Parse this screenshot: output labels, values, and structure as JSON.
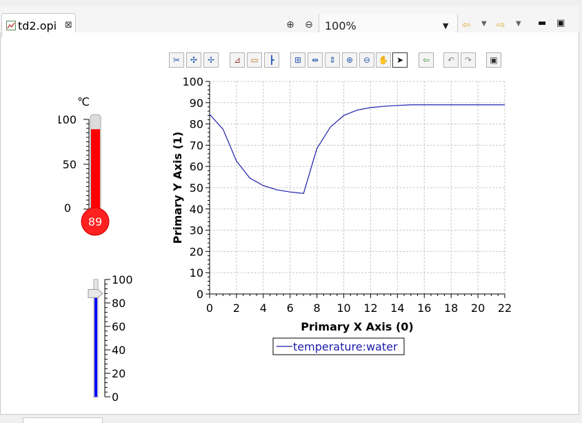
{
  "editor": {
    "tab_title": "td2.opi",
    "zoom_level": "100%",
    "icons": [
      "opi-file-icon",
      "close-icon",
      "zoom-in-icon",
      "zoom-out-icon",
      "dropdown-icon",
      "back-arrow-icon",
      "forward-arrow-icon",
      "minimize-icon",
      "maximize-icon"
    ]
  },
  "thermometer": {
    "unit": "℃",
    "value": 89,
    "value_label": "89",
    "min": 0,
    "max": 100,
    "tick_labels": [
      "100",
      "50",
      "0"
    ],
    "fill_color": "#ff0000"
  },
  "slider": {
    "value": 88,
    "min": 0,
    "max": 100,
    "tick_labels": [
      "100",
      "80",
      "60",
      "40",
      "20",
      "0"
    ],
    "fill_color": "#0000ff"
  },
  "graph_toolbar": {
    "buttons": [
      "configure-icon",
      "add-annotation-icon",
      "remove-annotation-icon",
      "autoscale-icon",
      "stagger-icon",
      "axis-icon",
      "rubberband-zoom-icon",
      "horizontal-zoom-icon",
      "vertical-zoom-icon",
      "zoom-in-icon",
      "zoom-out-icon",
      "panning-icon",
      "pointer-icon",
      "show-legend-icon",
      "undo-icon",
      "redo-icon",
      "snapshot-icon"
    ]
  },
  "chart_data": {
    "type": "line",
    "title": "",
    "xlabel": "Primary X Axis (0)",
    "ylabel": "Primary Y Axis (1)",
    "xlim": [
      0,
      22
    ],
    "ylim": [
      0,
      100
    ],
    "x_ticks": [
      "0",
      "2",
      "4",
      "6",
      "8",
      "10",
      "12",
      "14",
      "16",
      "18",
      "20",
      "22"
    ],
    "y_ticks": [
      "0",
      "10",
      "20",
      "30",
      "40",
      "50",
      "60",
      "70",
      "80",
      "90",
      "100"
    ],
    "grid": true,
    "legend": "bottom-center",
    "series": [
      {
        "name": "temperature:water",
        "color": "#1a1aaa",
        "x": [
          0,
          1,
          2,
          3,
          4,
          5,
          6,
          7,
          8,
          9,
          10,
          11,
          12,
          13,
          14,
          15,
          16,
          17,
          18,
          19,
          20,
          21,
          22
        ],
        "y": [
          84.5,
          77.5,
          62.5,
          54.5,
          51,
          49,
          48,
          47.3,
          68.5,
          78.5,
          84,
          86.5,
          87.7,
          88.3,
          88.7,
          89,
          89,
          89,
          89,
          89,
          89,
          89,
          89
        ]
      }
    ]
  }
}
